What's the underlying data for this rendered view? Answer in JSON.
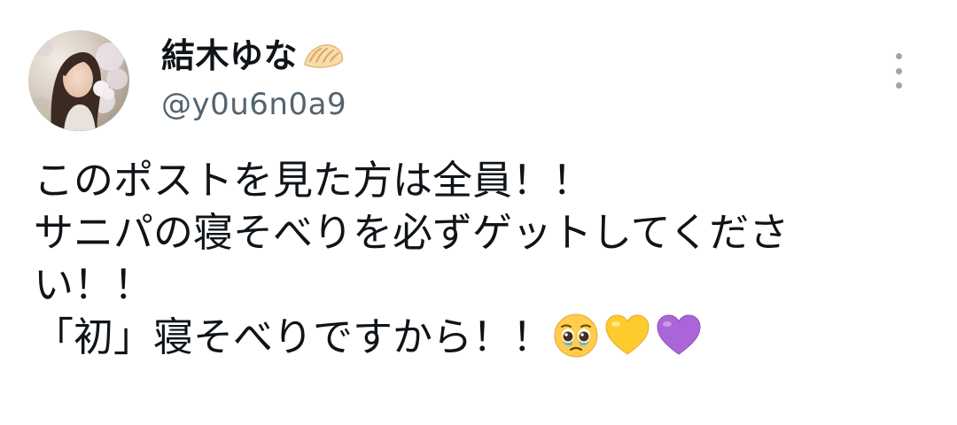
{
  "author": {
    "display_name": "結木ゆな",
    "name_emoji": "dumpling-icon",
    "handle": "@y0u6n0a9"
  },
  "menu": {
    "icon": "more-vertical-icon"
  },
  "tweet": {
    "lines": [
      "このポストを見た方は全員！！",
      "サニパの寝そべりを必ずゲットしてくださ",
      "い！！",
      "「初」寝そべりですから！！"
    ],
    "trailing_emojis": [
      "pleading-face-icon",
      "yellow-heart-icon",
      "purple-heart-icon"
    ]
  },
  "colors": {
    "text": "#0f1419",
    "secondary": "#536471",
    "background": "#ffffff"
  }
}
